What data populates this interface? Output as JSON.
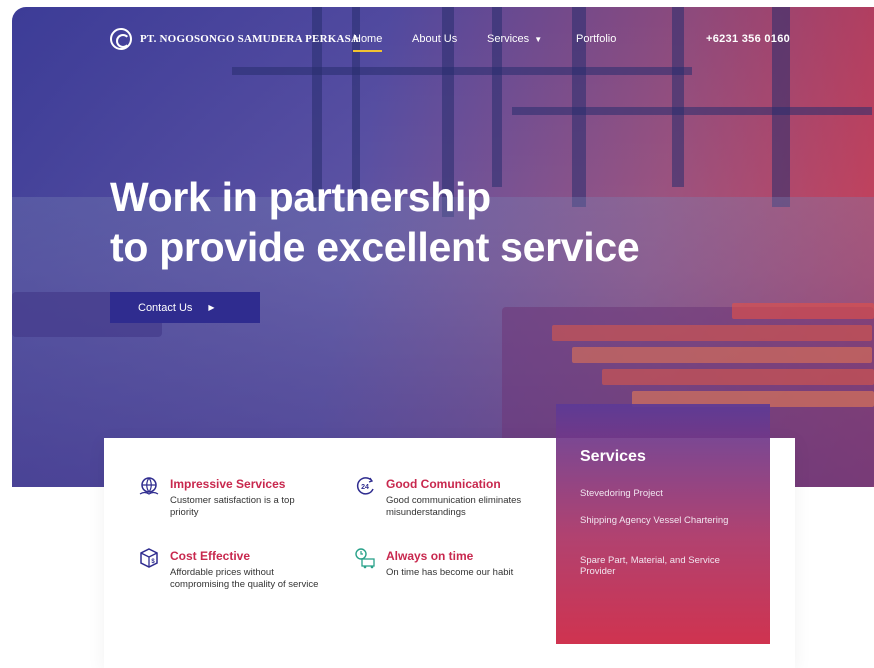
{
  "brand": {
    "name": "PT. NOGOSONGO SAMUDERA PERKASA"
  },
  "nav": {
    "items": [
      {
        "label": "Home",
        "active": true
      },
      {
        "label": "About Us",
        "active": false
      },
      {
        "label": "Services",
        "active": false
      },
      {
        "label": "Portfolio",
        "active": false
      }
    ],
    "phone": "+6231 356 0160"
  },
  "hero": {
    "line1": "Work in partnership",
    "line2": "to provide excellent service",
    "cta_label": "Contact Us"
  },
  "features": [
    {
      "title": "Impressive Services",
      "desc": "Customer satisfaction is a top priority",
      "icon": "globe-hands-icon"
    },
    {
      "title": "Good Comunication",
      "desc": "Good communication eliminates misunderstandings",
      "icon": "24h-icon"
    },
    {
      "title": "Cost Effective",
      "desc": "Affordable prices without compromising the quality of service",
      "icon": "box-icon"
    },
    {
      "title": "Always on time",
      "desc": "On time has become our habit",
      "icon": "delivery-clock-icon"
    }
  ],
  "services_card": {
    "title": "Services",
    "items": [
      "Stevedoring Project",
      "Shipping Agency Vessel Chartering",
      "Spare Part, Material, and Service Provider"
    ]
  },
  "colors": {
    "accent": "#c8284e",
    "primary": "#2f2c8f",
    "nav_underline": "#f2c230"
  }
}
